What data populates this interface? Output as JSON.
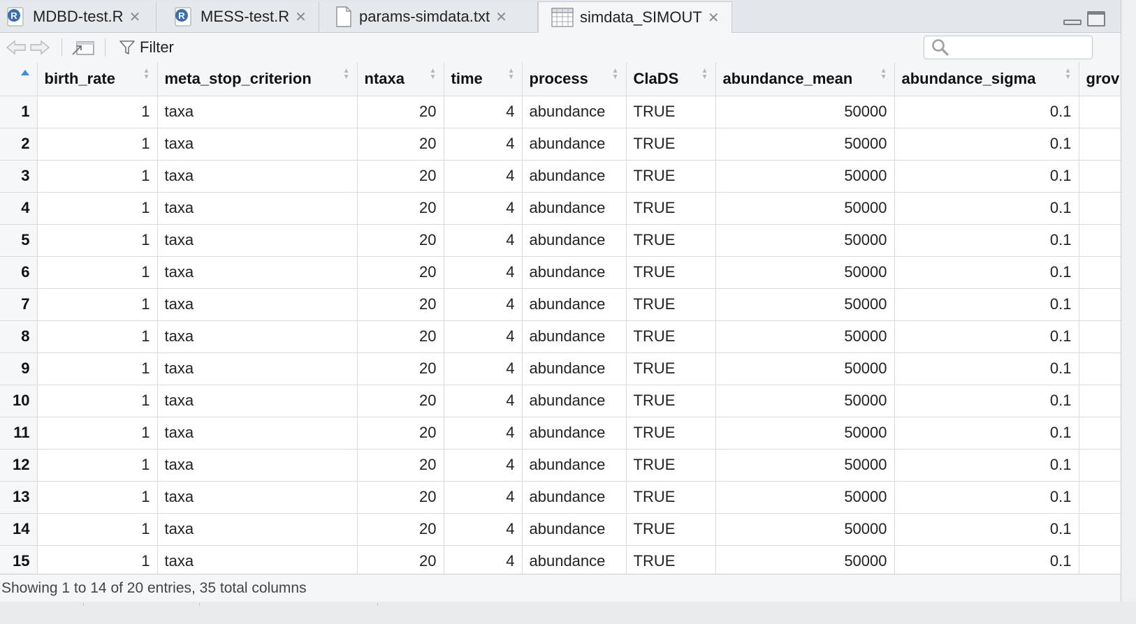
{
  "tabs": [
    {
      "label": "MDBD-test.R",
      "icon": "r-script-icon",
      "active": false
    },
    {
      "label": "MESS-test.R",
      "icon": "r-script-icon",
      "active": false
    },
    {
      "label": "params-simdata.txt",
      "icon": "text-file-icon",
      "active": false
    },
    {
      "label": "simdata_SIMOUT",
      "icon": "data-table-icon",
      "active": true
    }
  ],
  "toolbar": {
    "filter_label": "Filter",
    "search_placeholder": ""
  },
  "table": {
    "columns": [
      "birth_rate",
      "meta_stop_criterion",
      "ntaxa",
      "time",
      "process",
      "ClaDS",
      "abundance_mean",
      "abundance_sigma",
      "grov"
    ],
    "rows": [
      {
        "n": "1",
        "c": [
          "1",
          "taxa",
          "20",
          "4",
          "abundance",
          "TRUE",
          "50000",
          "0.1",
          ""
        ]
      },
      {
        "n": "2",
        "c": [
          "1",
          "taxa",
          "20",
          "4",
          "abundance",
          "TRUE",
          "50000",
          "0.1",
          ""
        ]
      },
      {
        "n": "3",
        "c": [
          "1",
          "taxa",
          "20",
          "4",
          "abundance",
          "TRUE",
          "50000",
          "0.1",
          ""
        ]
      },
      {
        "n": "4",
        "c": [
          "1",
          "taxa",
          "20",
          "4",
          "abundance",
          "TRUE",
          "50000",
          "0.1",
          ""
        ]
      },
      {
        "n": "5",
        "c": [
          "1",
          "taxa",
          "20",
          "4",
          "abundance",
          "TRUE",
          "50000",
          "0.1",
          ""
        ]
      },
      {
        "n": "6",
        "c": [
          "1",
          "taxa",
          "20",
          "4",
          "abundance",
          "TRUE",
          "50000",
          "0.1",
          ""
        ]
      },
      {
        "n": "7",
        "c": [
          "1",
          "taxa",
          "20",
          "4",
          "abundance",
          "TRUE",
          "50000",
          "0.1",
          ""
        ]
      },
      {
        "n": "8",
        "c": [
          "1",
          "taxa",
          "20",
          "4",
          "abundance",
          "TRUE",
          "50000",
          "0.1",
          ""
        ]
      },
      {
        "n": "9",
        "c": [
          "1",
          "taxa",
          "20",
          "4",
          "abundance",
          "TRUE",
          "50000",
          "0.1",
          ""
        ]
      },
      {
        "n": "10",
        "c": [
          "1",
          "taxa",
          "20",
          "4",
          "abundance",
          "TRUE",
          "50000",
          "0.1",
          ""
        ]
      },
      {
        "n": "11",
        "c": [
          "1",
          "taxa",
          "20",
          "4",
          "abundance",
          "TRUE",
          "50000",
          "0.1",
          ""
        ]
      },
      {
        "n": "12",
        "c": [
          "1",
          "taxa",
          "20",
          "4",
          "abundance",
          "TRUE",
          "50000",
          "0.1",
          ""
        ]
      },
      {
        "n": "13",
        "c": [
          "1",
          "taxa",
          "20",
          "4",
          "abundance",
          "TRUE",
          "50000",
          "0.1",
          ""
        ]
      },
      {
        "n": "14",
        "c": [
          "1",
          "taxa",
          "20",
          "4",
          "abundance",
          "TRUE",
          "50000",
          "0.1",
          ""
        ]
      },
      {
        "n": "15",
        "c": [
          "1",
          "taxa",
          "20",
          "4",
          "abundance",
          "TRUE",
          "50000",
          "0.1",
          ""
        ]
      }
    ]
  },
  "status": {
    "text": "Showing 1 to 14 of 20 entries, 35 total columns"
  },
  "colors": {
    "tabbar_bg": "#e3e6ea",
    "active_tab_bg": "#f4f6f8",
    "header_bg": "#f4f6f8",
    "grid_line": "#d8dbde",
    "r_icon_blue": "#3a6fb0",
    "sort_asc_blue": "#3d8de0"
  }
}
